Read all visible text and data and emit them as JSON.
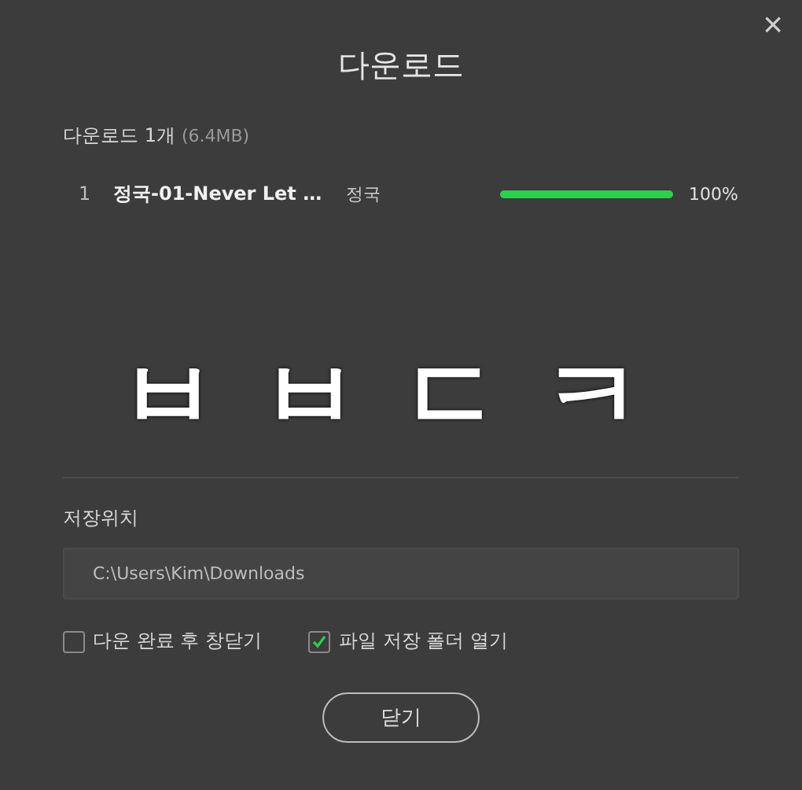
{
  "window": {
    "title": "다운로드",
    "close": "×"
  },
  "summary": {
    "label": "다운로드 1개",
    "size": "(6.4MB)"
  },
  "downloads": [
    {
      "index": "1",
      "title": "정국-01-Never Let …",
      "artist": "정국",
      "level": 1,
      "percent": "100%"
    }
  ],
  "overlay_text": "ㅂㅂㄷㅋ",
  "save_location": {
    "label": "저장위치",
    "path": "C:\\Users\\Kim\\Downloads"
  },
  "options": [
    {
      "label": "다운 완료 후 창닫기",
      "checked": false
    },
    {
      "label": "파일 저장 폴더 열기",
      "checked": true
    }
  ],
  "buttons": [
    "닫기"
  ]
}
